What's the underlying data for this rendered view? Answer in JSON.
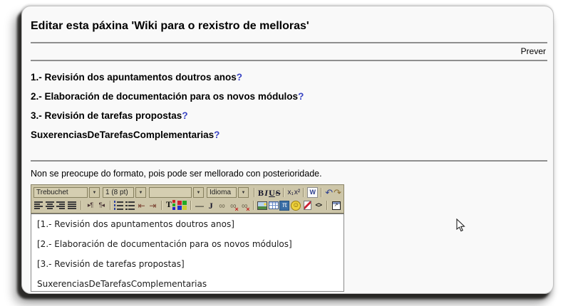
{
  "page": {
    "title": "Editar esta páxina 'Wiki para o rexistro de melloras'",
    "preview_label": "Prever",
    "items": [
      {
        "text": "1.- Revisión dos apuntamentos doutros anos",
        "link": "?"
      },
      {
        "text": "2.- Elaboración de documentación para os novos módulos",
        "link": "?"
      },
      {
        "text": "3.- Revisión de tarefas propostas",
        "link": "?"
      },
      {
        "text": "SuxerenciasDeTarefasComplementarias",
        "link": "?"
      }
    ],
    "note": "Non se preocupe do formato, pois pode ser mellorado con posterioridade."
  },
  "editor": {
    "toolbar": {
      "arrow": "▼",
      "row1": [
        {
          "t": "sel",
          "n": "font-family-select",
          "v": "Trebuchet"
        },
        {
          "t": "sel",
          "n": "font-size-select",
          "v": "1 (8 pt)"
        },
        {
          "t": "sel",
          "n": "format-select",
          "v": ""
        },
        {
          "t": "sel",
          "n": "language-select",
          "v": "Idioma"
        },
        {
          "t": "sep"
        },
        {
          "t": "b",
          "n": "bold-button",
          "g": "B",
          "c": "gB"
        },
        {
          "t": "b",
          "n": "italic-button",
          "g": "I",
          "c": "gI"
        },
        {
          "t": "b",
          "n": "underline-button",
          "g": "U",
          "c": "gU"
        },
        {
          "t": "b",
          "n": "strikethrough-button",
          "g": "S",
          "c": "gS"
        },
        {
          "t": "sep"
        },
        {
          "t": "b",
          "n": "subscript-button",
          "g": "x₁",
          "c": "gSub"
        },
        {
          "t": "b",
          "n": "superscript-button",
          "g": "x²",
          "c": "gSup"
        },
        {
          "t": "sep"
        },
        {
          "t": "b",
          "n": "clean-word-html-button",
          "g": "W",
          "c": "gW"
        },
        {
          "t": "sep"
        },
        {
          "t": "b",
          "n": "undo-button",
          "g": "↶",
          "c": "gUndo"
        },
        {
          "t": "b",
          "n": "redo-button",
          "g": "↷",
          "c": "gRedo"
        }
      ],
      "row2": [
        {
          "t": "ci",
          "n": "align-left-button",
          "c": "icAL"
        },
        {
          "t": "ci",
          "n": "align-center-button",
          "c": "icAC"
        },
        {
          "t": "ci",
          "n": "align-right-button",
          "c": "icAR"
        },
        {
          "t": "ci",
          "n": "align-justify-button",
          "c": "icAJ"
        },
        {
          "t": "sep"
        },
        {
          "t": "b",
          "n": "direction-ltr-button",
          "g": "▸¶",
          "c": "gDir"
        },
        {
          "t": "b",
          "n": "direction-rtl-button",
          "g": "¶◂",
          "c": "gDir"
        },
        {
          "t": "sep"
        },
        {
          "t": "ci",
          "n": "ordered-list-button",
          "c": "icOL"
        },
        {
          "t": "ci",
          "n": "unordered-list-button",
          "c": "icUL"
        },
        {
          "t": "b",
          "n": "outdent-button",
          "g": "⇤",
          "c": "gInd"
        },
        {
          "t": "b",
          "n": "indent-button",
          "g": "⇥",
          "c": "gInd"
        },
        {
          "t": "sep"
        },
        {
          "t": "b",
          "n": "text-color-button",
          "g": "T",
          "c": "gTC"
        },
        {
          "t": "ci",
          "n": "highlight-color-button",
          "c": "icBC"
        },
        {
          "t": "sep"
        },
        {
          "t": "b",
          "n": "horizontal-rule-button",
          "g": "—",
          "c": "gHR"
        },
        {
          "t": "b",
          "n": "anchor-button",
          "g": "J",
          "c": "gAnchor"
        },
        {
          "t": "b",
          "n": "link-button",
          "g": "∞",
          "c": "gLink"
        },
        {
          "t": "b",
          "n": "unlink-button",
          "g": "∞",
          "c": "gLink xov"
        },
        {
          "t": "b",
          "n": "no-autolink-button",
          "g": "∞",
          "c": "gLink xov"
        },
        {
          "t": "sep"
        },
        {
          "t": "ci",
          "n": "insert-image-button",
          "c": "icIMG"
        },
        {
          "t": "ci",
          "n": "insert-table-button",
          "c": "icTBL"
        },
        {
          "t": "b",
          "n": "insert-special-char-button",
          "g": "π",
          "c": "gPI"
        },
        {
          "t": "b",
          "n": "insert-smiley-button",
          "g": "☺",
          "c": "gSMILE"
        },
        {
          "t": "ci",
          "n": "spellcheck-button",
          "c": "icSPELL"
        },
        {
          "t": "b",
          "n": "html-source-button",
          "g": "<>",
          "c": "gsrc"
        },
        {
          "t": "sep"
        },
        {
          "t": "b",
          "n": "enlarge-editor-button",
          "g": "↗",
          "c": "gPOP"
        }
      ]
    },
    "content": [
      "[1.- Revisión dos apuntamentos doutros anos]",
      "[2.- Elaboración de documentación para os novos módulos]",
      "[3.- Revisión de tarefas propostas]",
      "SuxerenciasDeTarefasComplementarias"
    ]
  },
  "colors": {
    "toolbar_bg": "#cdc6a9",
    "link_blue": "#3a45c4",
    "rule_gray": "#8f8f8f",
    "page_bg": "#f9f9f9"
  }
}
